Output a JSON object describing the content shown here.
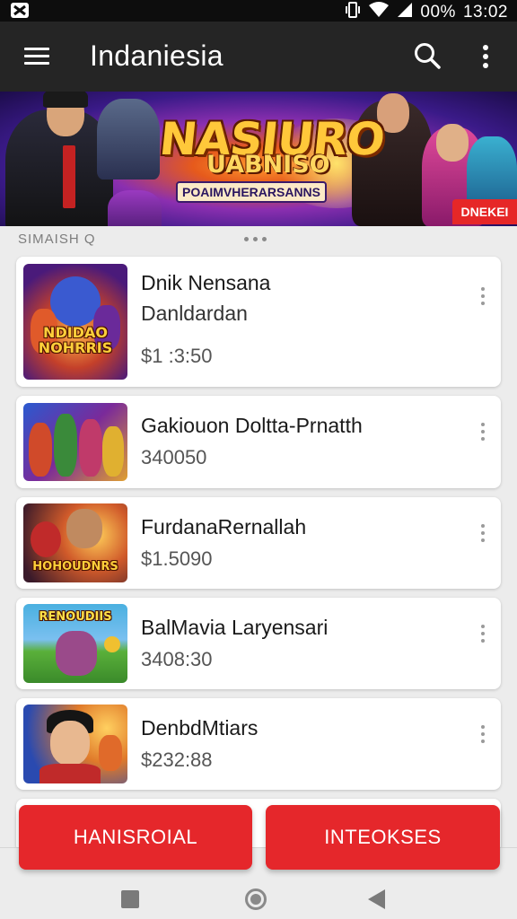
{
  "status_bar": {
    "battery": "00%",
    "time": "13:02"
  },
  "app_bar": {
    "title": "Indaniesia"
  },
  "banner": {
    "title": "NASIURO",
    "subtitle": "UABNISO",
    "tagline": "POAIMVHERARSANNS",
    "badge": "DNEKEI"
  },
  "section": {
    "label": "SIMAISH Q"
  },
  "items": [
    {
      "title": "Dnik Nensana",
      "subtitle": "Danldardan",
      "price": "$1 :3:50",
      "thumb_text": "NDIDAO NOHRRIS"
    },
    {
      "title": "Gakiouon Doltta-Prnatth",
      "subtitle": "",
      "price": "340050",
      "thumb_text": ""
    },
    {
      "title": "FurdanaRernallah",
      "subtitle": "",
      "price": "$1.5090",
      "thumb_text": "HOHOUDNRS"
    },
    {
      "title": "BalMavia Laryensari",
      "subtitle": "",
      "price": "3408:30",
      "thumb_text": "RENOUDIIS"
    },
    {
      "title": "DenbdMtiars",
      "subtitle": "",
      "price": "$232:88",
      "thumb_text": ""
    }
  ],
  "buttons": {
    "left": "HANISROIAL",
    "right": "INTEOKSES"
  },
  "colors": {
    "app_bar": "#252525",
    "accent_red": "#e5272b",
    "background": "#ececec"
  }
}
